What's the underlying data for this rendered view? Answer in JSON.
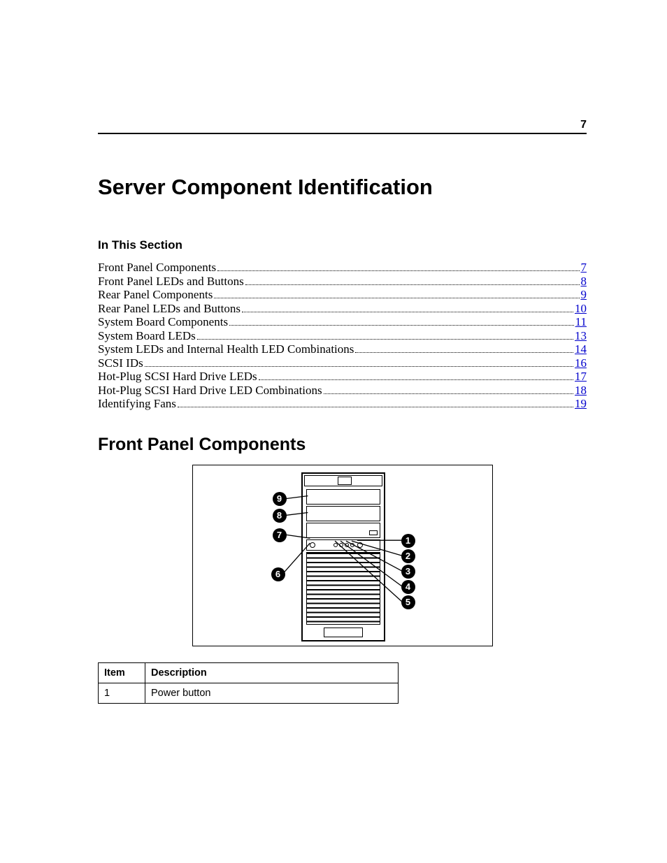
{
  "page_number": "7",
  "title": "Server Component Identification",
  "in_this_section_label": "In This Section",
  "toc": [
    {
      "label": "Front Panel Components",
      "page": "7"
    },
    {
      "label": "Front Panel LEDs and Buttons",
      "page": "8"
    },
    {
      "label": "Rear Panel Components",
      "page": "9"
    },
    {
      "label": "Rear Panel LEDs and Buttons",
      "page": "10"
    },
    {
      "label": "System Board Components",
      "page": "11"
    },
    {
      "label": "System Board LEDs",
      "page": "13"
    },
    {
      "label": "System LEDs and Internal Health LED Combinations",
      "page": "14"
    },
    {
      "label": "SCSI IDs",
      "page": "16"
    },
    {
      "label": "Hot-Plug SCSI Hard Drive LEDs",
      "page": "17"
    },
    {
      "label": "Hot-Plug SCSI Hard Drive LED Combinations",
      "page": "18"
    },
    {
      "label": "Identifying Fans",
      "page": "19"
    }
  ],
  "section_heading": "Front Panel Components",
  "callouts": {
    "left": [
      "9",
      "8",
      "7",
      "6"
    ],
    "right": [
      "1",
      "2",
      "3",
      "4",
      "5"
    ]
  },
  "table": {
    "headers": {
      "item": "Item",
      "description": "Description"
    },
    "rows": [
      {
        "item": "1",
        "description": "Power button"
      }
    ]
  }
}
